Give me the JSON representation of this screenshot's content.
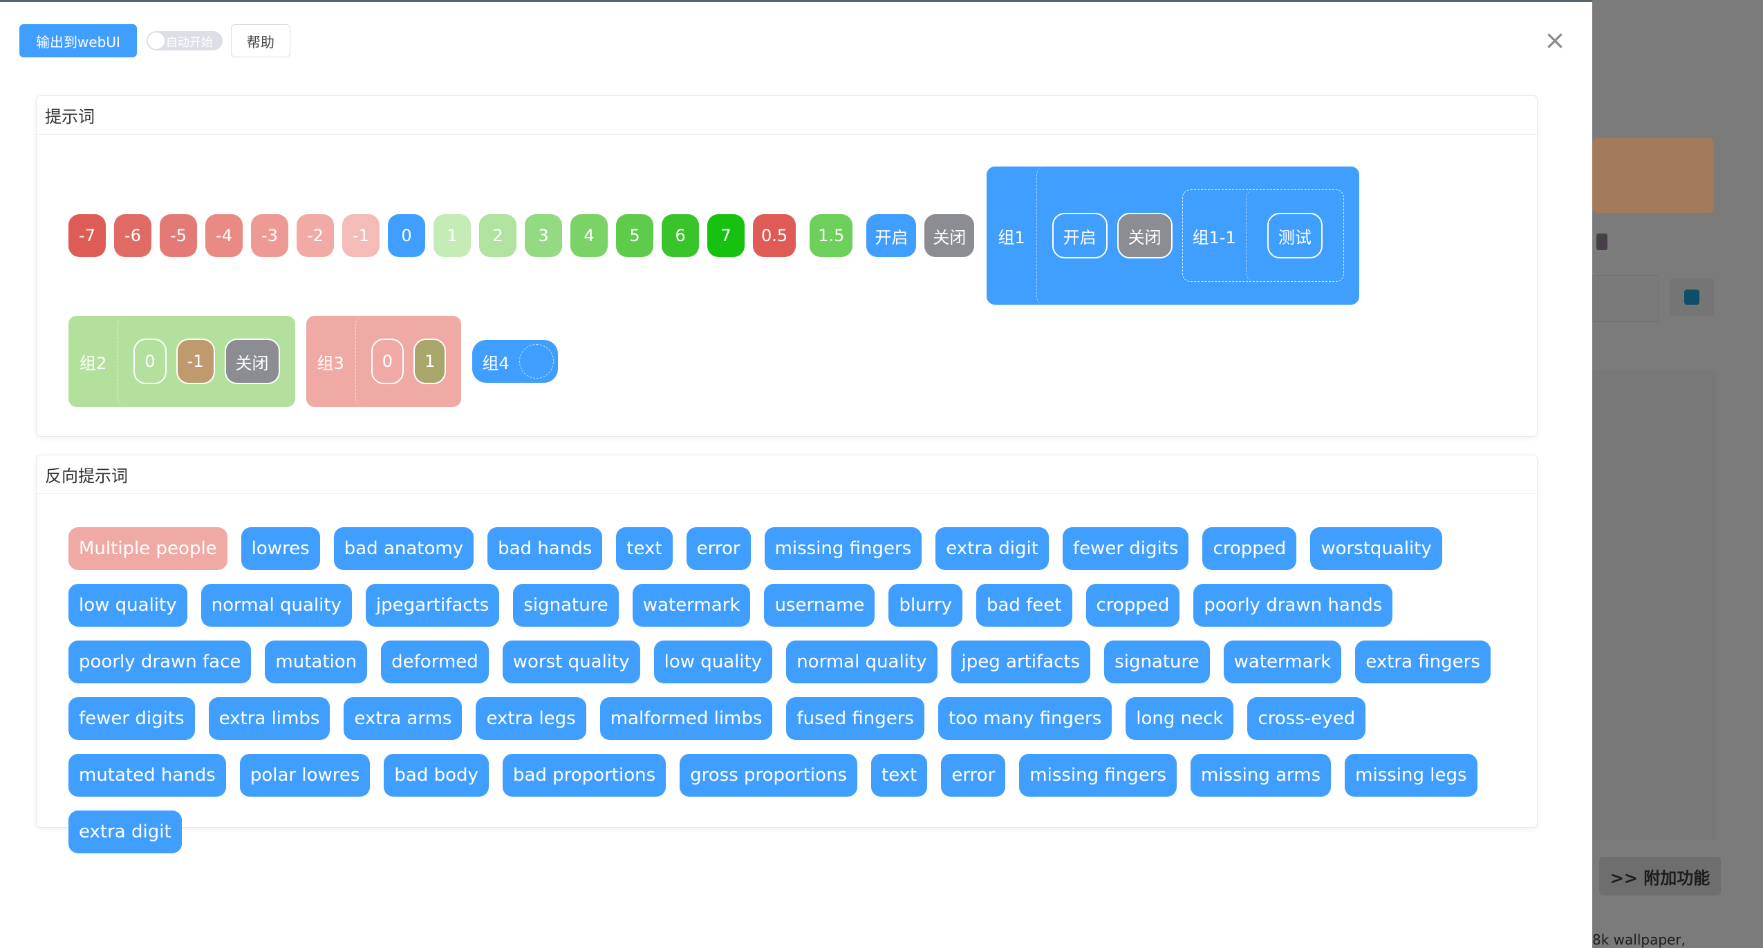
{
  "toolbar": {
    "output_label": "输出到webUI",
    "autostart_label": "自动开始",
    "help_label": "帮助"
  },
  "prompt_panel": {
    "title": "提示词",
    "weight_chips": [
      {
        "label": "-7",
        "color": "#df5b55"
      },
      {
        "label": "-6",
        "color": "#e06a64"
      },
      {
        "label": "-5",
        "color": "#e47a75"
      },
      {
        "label": "-4",
        "color": "#e98a84"
      },
      {
        "label": "-3",
        "color": "#ed9a95"
      },
      {
        "label": "-2",
        "color": "#f1aaa5"
      },
      {
        "label": "-1",
        "color": "#f4bbb7"
      },
      {
        "label": "0",
        "color": "#409eff"
      },
      {
        "label": "1",
        "color": "#c5ecb6"
      },
      {
        "label": "2",
        "color": "#b0e39f"
      },
      {
        "label": "3",
        "color": "#94da82"
      },
      {
        "label": "4",
        "color": "#7bd266"
      },
      {
        "label": "5",
        "color": "#5ecb4a"
      },
      {
        "label": "6",
        "color": "#39c42c"
      },
      {
        "label": "7",
        "color": "#17c10f"
      },
      {
        "label": "0.5",
        "color": "#df5b55"
      },
      {
        "label": "1.5",
        "color": "#6cd05a"
      }
    ],
    "open_label": "开启",
    "close_label": "关闭",
    "group1": {
      "label": "组1",
      "open_label": "开启",
      "close_label": "关闭",
      "subgroup": {
        "label": "组1-1",
        "test_label": "测试"
      }
    },
    "group2": {
      "label": "组2",
      "chips": [
        {
          "label": "0",
          "color": "#b3e19d"
        },
        {
          "label": "-1",
          "color": "#bf9a6e"
        },
        {
          "label": "关闭",
          "color": "#8b8d92"
        }
      ]
    },
    "group3": {
      "label": "组3",
      "chips": [
        {
          "label": "0",
          "color": "#f0aaa6"
        },
        {
          "label": "1",
          "color": "#a9a66c"
        }
      ]
    },
    "group4": {
      "label": "组4"
    }
  },
  "negative_panel": {
    "title": "反向提示词",
    "tags": [
      "Multiple people",
      "lowres",
      "bad anatomy",
      "bad hands",
      "text",
      "error",
      "missing fingers",
      "extra digit",
      "fewer digits",
      "cropped",
      "worstquality",
      "low quality",
      "normal quality",
      "jpegartifacts",
      "signature",
      "watermark",
      "username",
      "blurry",
      "bad feet",
      "cropped",
      "poorly drawn hands",
      "poorly drawn face",
      "mutation",
      "deformed",
      "worst quality",
      "low quality",
      "normal quality",
      "jpeg artifacts",
      "signature",
      "watermark",
      "extra fingers",
      "fewer digits",
      "extra limbs",
      "extra arms",
      "extra legs",
      "malformed limbs",
      "fused fingers",
      "too many fingers",
      "long neck",
      "cross-eyed",
      "mutated hands",
      "polar lowres",
      "bad body",
      "bad proportions",
      "gross proportions",
      "text",
      "error",
      "missing fingers",
      "missing arms",
      "missing legs",
      "extra digit"
    ]
  },
  "background": {
    "extra_button_label": ">> 附加功能",
    "bottom_text": "8k wallpaper,"
  },
  "colors": {
    "primary": "#409eff",
    "neutral": "#8b8d92",
    "group2_bg": "#b3e19d",
    "group3_bg": "#f0aaa6"
  }
}
